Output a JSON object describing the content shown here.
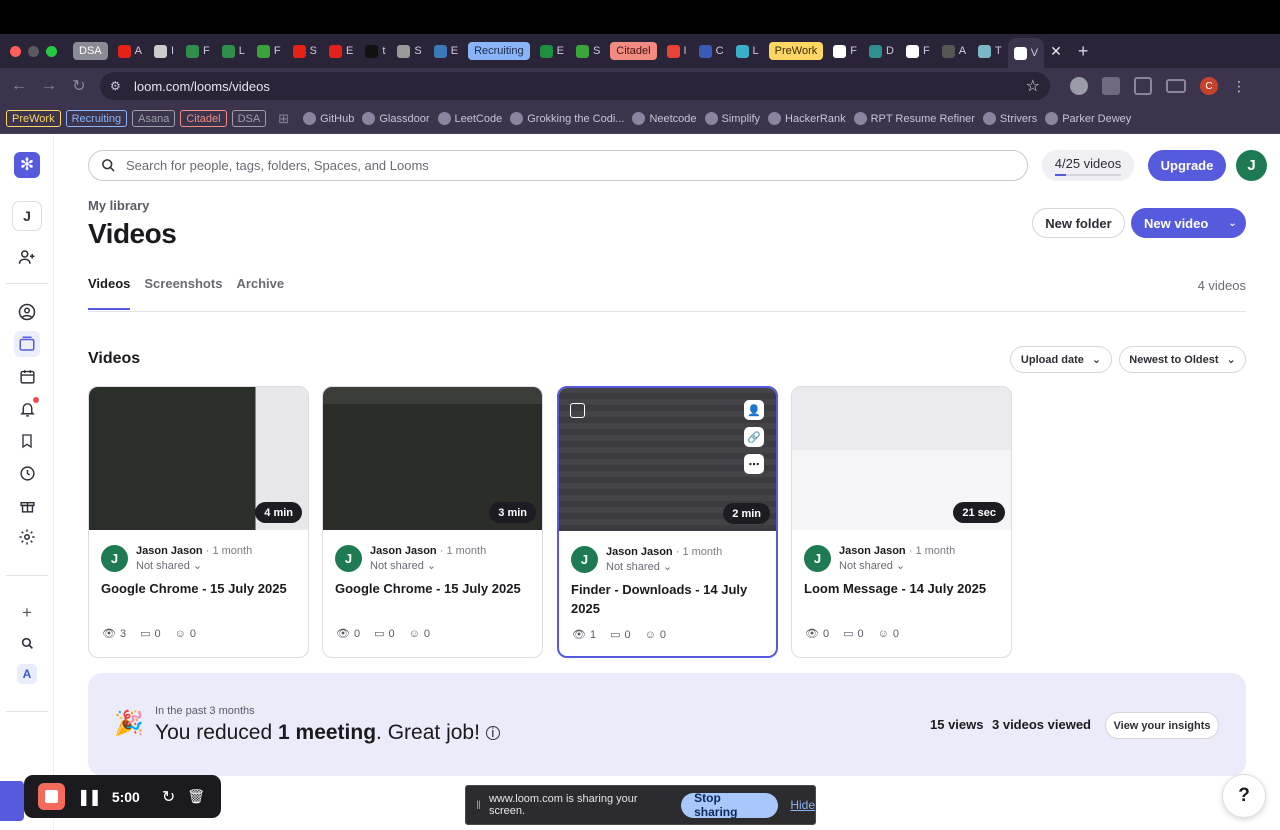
{
  "browser": {
    "url": "loom.com/looms/videos",
    "tabs": [
      {
        "type": "group",
        "label": "DSA",
        "bg": "#8b8b95",
        "fg": "#ffffff"
      },
      {
        "type": "tab",
        "icon_color": "#e62117",
        "label": "A"
      },
      {
        "type": "tab",
        "icon_color": "#cccccc",
        "label": "I"
      },
      {
        "type": "tab",
        "icon_color": "#2f8f4a",
        "label": "F"
      },
      {
        "type": "tab",
        "icon_color": "#2f8f4a",
        "label": "L"
      },
      {
        "type": "tab",
        "icon_color": "#3aa33a",
        "label": "F"
      },
      {
        "type": "tab",
        "icon_color": "#e62117",
        "label": "S"
      },
      {
        "type": "tab",
        "icon_color": "#e62117",
        "label": "E"
      },
      {
        "type": "tab",
        "icon_color": "#111111",
        "label": "t"
      },
      {
        "type": "tab",
        "icon_color": "#999999",
        "label": "S"
      },
      {
        "type": "tab",
        "icon_color": "#3b79b8",
        "label": "E"
      },
      {
        "type": "group",
        "label": "Recruiting",
        "bg": "#8ab4f8",
        "fg": "#1b2a4a"
      },
      {
        "type": "tab",
        "icon_color": "#1e8e3e",
        "label": "E"
      },
      {
        "type": "tab",
        "icon_color": "#3aa33a",
        "label": "S"
      },
      {
        "type": "group",
        "label": "Citadel",
        "bg": "#f28b82",
        "fg": "#4a1210"
      },
      {
        "type": "tab",
        "icon_color": "#ea4335",
        "label": "I"
      },
      {
        "type": "tab",
        "icon_color": "#3a5ab8",
        "label": "C"
      },
      {
        "type": "tab",
        "icon_color": "#3ab0c8",
        "label": "L"
      },
      {
        "type": "group",
        "label": "PreWork",
        "bg": "#fdd663",
        "fg": "#3a2e00"
      },
      {
        "type": "tab",
        "icon_color": "#ffffff",
        "label": "F"
      },
      {
        "type": "tab",
        "icon_color": "#2f8f8f",
        "label": "D"
      },
      {
        "type": "tab",
        "icon_color": "#ffffff",
        "label": "F"
      },
      {
        "type": "tab",
        "icon_color": "#555555",
        "label": "A"
      },
      {
        "type": "tab",
        "icon_color": "#7ab8c8",
        "label": "T"
      },
      {
        "type": "tab",
        "icon_color": "#ffffff",
        "label": "V",
        "active": true
      }
    ],
    "bookmarks_groups": [
      {
        "label": "PreWork",
        "color": "#fdd663"
      },
      {
        "label": "Recruiting",
        "color": "#8ab4f8"
      },
      {
        "label": "Asana",
        "color": "#9aa0a6"
      },
      {
        "label": "Citadel",
        "color": "#f28b82"
      },
      {
        "label": "DSA",
        "color": "#9aa0a6"
      }
    ],
    "bookmarks": [
      "GitHub",
      "Glassdoor",
      "LeetCode",
      "Grokking the Codi...",
      "Neetcode",
      "Simplify",
      "HackerRank",
      "RPT Resume Refiner",
      "Strivers",
      "Parker Dewey"
    ],
    "profile_initial": "C"
  },
  "sidebar": {
    "workspace_initial": "J"
  },
  "header": {
    "search_placeholder": "Search for people, tags, folders, Spaces, and Looms",
    "quota_text": "4/25 videos",
    "quota_progress": 0.16,
    "upgrade_label": "Upgrade",
    "avatar_initial": "J"
  },
  "page": {
    "breadcrumb": "My library",
    "title": "Videos",
    "new_folder_label": "New folder",
    "new_video_label": "New video",
    "tabs": [
      "Videos",
      "Screenshots",
      "Archive"
    ],
    "active_tab": "Videos",
    "video_count": "4 videos",
    "section_title": "Videos",
    "sort_field": "Upload date",
    "sort_order": "Newest to Oldest"
  },
  "videos": [
    {
      "author": "Jason Jason",
      "age": "1 month",
      "sharing": "Not shared",
      "title": "Google Chrome - 15 July 2025",
      "duration": "4 min",
      "views": "3",
      "comments": "0",
      "reactions": "0"
    },
    {
      "author": "Jason Jason",
      "age": "1 month",
      "sharing": "Not shared",
      "title": "Google Chrome - 15 July 2025",
      "duration": "3 min",
      "views": "0",
      "comments": "0",
      "reactions": "0"
    },
    {
      "author": "Jason Jason",
      "age": "1 month",
      "sharing": "Not shared",
      "title": "Finder - Downloads - 14 July 2025",
      "duration": "2 min",
      "views": "1",
      "comments": "0",
      "reactions": "0"
    },
    {
      "author": "Jason Jason",
      "age": "1 month",
      "sharing": "Not shared",
      "title": "Loom Message - 14 July 2025",
      "duration": "21 sec",
      "views": "0",
      "comments": "0",
      "reactions": "0"
    }
  ],
  "insights": {
    "period": "In the past 3 months",
    "message_prefix": "You reduced",
    "message_highlight": "1 meeting",
    "message_suffix": ". Great job!",
    "views": "15 views",
    "videos_viewed": "3 videos viewed",
    "button_label": "View your insights"
  },
  "recording": {
    "time": "5:00"
  },
  "share_notice": {
    "text": "www.loom.com is sharing your screen.",
    "stop_label": "Stop sharing",
    "hide_label": "Hide"
  },
  "help_label": "?",
  "colors": {
    "accent": "#565add",
    "avatar_green": "#1e7a52",
    "record_red": "#f26b5b"
  }
}
